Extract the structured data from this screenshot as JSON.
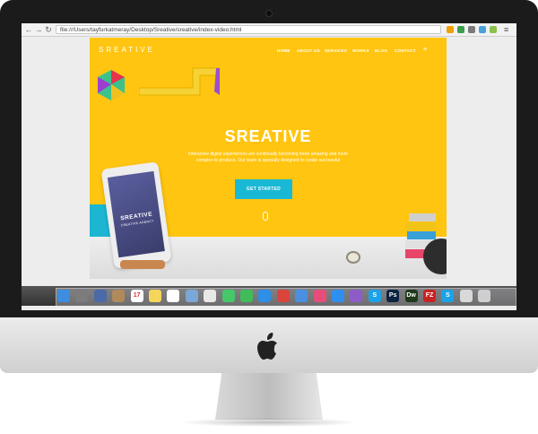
{
  "browser": {
    "url": "file:///Users/tayfurkatmeray/Desktop/Sreative/sreative/index-video.html",
    "back_icon": "←",
    "forward_icon": "→",
    "reload_icon": "↻"
  },
  "site": {
    "logo": "SREATIVE",
    "nav": [
      "HOME",
      "ABOUT US",
      "SERVICES",
      "WORKS",
      "BLOG",
      "CONTACT"
    ],
    "menu_icon": "≡",
    "hero_title": "SREATIVE",
    "hero_text": "Interactive digital experiences are continually becoming more amazing and more complex to produce. Our team is specially designed to create successful",
    "cta_label": "GET STARTED",
    "tablet_brand": "SREATIVE",
    "tablet_sub": "CREATIVE AGENCY",
    "accent_color": "#ffc510",
    "button_color": "#19b9d5"
  },
  "dock": {
    "calendar_day": "17",
    "icons": [
      {
        "name": "finder",
        "glyph": "",
        "color": "#3d8de0"
      },
      {
        "name": "launchpad",
        "glyph": "",
        "color": "#7c7c7c"
      },
      {
        "name": "mission-control",
        "glyph": "",
        "color": "#4a6aa8"
      },
      {
        "name": "contacts",
        "glyph": "",
        "color": "#b08a5a"
      },
      {
        "name": "calendar",
        "glyph": "17",
        "color": "#ffffff"
      },
      {
        "name": "notes",
        "glyph": "",
        "color": "#f6d55b"
      },
      {
        "name": "reminders",
        "glyph": "",
        "color": "#ffffff"
      },
      {
        "name": "preview",
        "glyph": "",
        "color": "#7aa7d6"
      },
      {
        "name": "photos",
        "glyph": "",
        "color": "#e8e8e8"
      },
      {
        "name": "messages",
        "glyph": "",
        "color": "#44c86a"
      },
      {
        "name": "facetime",
        "glyph": "",
        "color": "#3ebd59"
      },
      {
        "name": "safari",
        "glyph": "",
        "color": "#2d8fe6"
      },
      {
        "name": "chrome",
        "glyph": "",
        "color": "#d9443b"
      },
      {
        "name": "mail",
        "glyph": "",
        "color": "#4a8fe0"
      },
      {
        "name": "itunes",
        "glyph": "",
        "color": "#e84d7a"
      },
      {
        "name": "app-store",
        "glyph": "",
        "color": "#2f8ff0"
      },
      {
        "name": "ibooks",
        "glyph": "",
        "color": "#8e5cc8"
      },
      {
        "name": "skype",
        "glyph": "S",
        "color": "#1aa3e8"
      },
      {
        "name": "photoshop",
        "glyph": "Ps",
        "color": "#0b2340"
      },
      {
        "name": "dreamweaver",
        "glyph": "Dw",
        "color": "#1f3a1a"
      },
      {
        "name": "filezilla",
        "glyph": "FZ",
        "color": "#c82222"
      },
      {
        "name": "skype-2",
        "glyph": "S",
        "color": "#1aa3e8"
      },
      {
        "name": "documents",
        "glyph": "",
        "color": "#d9d9d9"
      },
      {
        "name": "trash",
        "glyph": "",
        "color": "#cfcfcf"
      }
    ]
  }
}
